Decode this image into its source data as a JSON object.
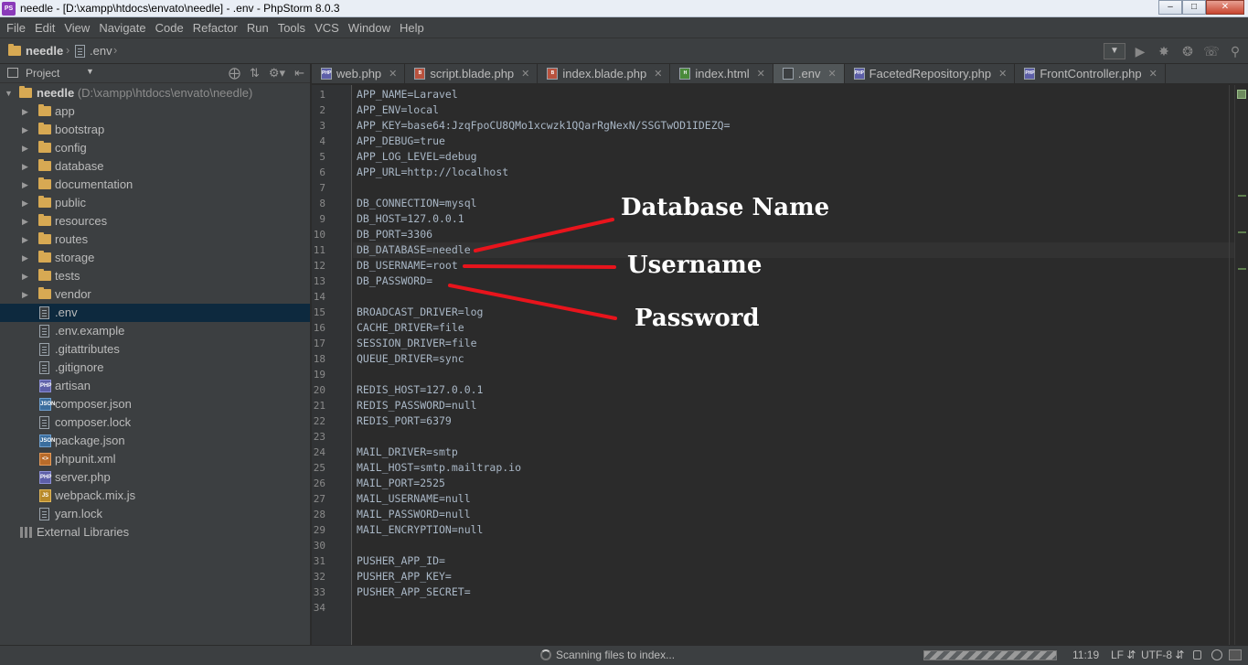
{
  "window": {
    "title": "needle - [D:\\xampp\\htdocs\\envato\\needle] - .env - PhpStorm 8.0.3",
    "controls": [
      "–",
      "□",
      "✕"
    ]
  },
  "menu": [
    "File",
    "Edit",
    "View",
    "Navigate",
    "Code",
    "Refactor",
    "Run",
    "Tools",
    "VCS",
    "Window",
    "Help"
  ],
  "breadcrumb": {
    "project": "needle",
    "file": ".env"
  },
  "project_panel": {
    "label": "Project",
    "root_name": "needle",
    "root_path": "(D:\\xampp\\htdocs\\envato\\needle)",
    "folders": [
      "app",
      "bootstrap",
      "config",
      "database",
      "documentation",
      "public",
      "resources",
      "routes",
      "storage",
      "tests",
      "vendor"
    ],
    "files": [
      {
        "name": ".env",
        "icon": "text"
      },
      {
        "name": ".env.example",
        "icon": "text"
      },
      {
        "name": ".gitattributes",
        "icon": "text"
      },
      {
        "name": ".gitignore",
        "icon": "text"
      },
      {
        "name": "artisan",
        "icon": "php"
      },
      {
        "name": "composer.json",
        "icon": "json"
      },
      {
        "name": "composer.lock",
        "icon": "text"
      },
      {
        "name": "package.json",
        "icon": "json"
      },
      {
        "name": "phpunit.xml",
        "icon": "xml"
      },
      {
        "name": "server.php",
        "icon": "php"
      },
      {
        "name": "webpack.mix.js",
        "icon": "js"
      },
      {
        "name": "yarn.lock",
        "icon": "text"
      }
    ],
    "external_libraries": "External Libraries",
    "selected": ".env"
  },
  "tabs": [
    {
      "label": "web.php",
      "icon": "php"
    },
    {
      "label": "script.blade.php",
      "icon": "blade"
    },
    {
      "label": "index.blade.php",
      "icon": "blade"
    },
    {
      "label": "index.html",
      "icon": "html"
    },
    {
      "label": ".env",
      "icon": "env",
      "active": true
    },
    {
      "label": "FacetedRepository.php",
      "icon": "php"
    },
    {
      "label": "FrontController.php",
      "icon": "php"
    }
  ],
  "editor": {
    "current_line": 11,
    "lines": [
      "APP_NAME=Laravel",
      "APP_ENV=local",
      "APP_KEY=base64:JzqFpoCU8QMo1xcwzk1QQarRgNexN/SSGTwOD1IDEZQ=",
      "APP_DEBUG=true",
      "APP_LOG_LEVEL=debug",
      "APP_URL=http://localhost",
      "",
      "DB_CONNECTION=mysql",
      "DB_HOST=127.0.0.1",
      "DB_PORT=3306",
      "DB_DATABASE=needle",
      "DB_USERNAME=root",
      "DB_PASSWORD=",
      "",
      "BROADCAST_DRIVER=log",
      "CACHE_DRIVER=file",
      "SESSION_DRIVER=file",
      "QUEUE_DRIVER=sync",
      "",
      "REDIS_HOST=127.0.0.1",
      "REDIS_PASSWORD=null",
      "REDIS_PORT=6379",
      "",
      "MAIL_DRIVER=smtp",
      "MAIL_HOST=smtp.mailtrap.io",
      "MAIL_PORT=2525",
      "MAIL_USERNAME=null",
      "MAIL_PASSWORD=null",
      "MAIL_ENCRYPTION=null",
      "",
      "PUSHER_APP_ID=",
      "PUSHER_APP_KEY=",
      "PUSHER_APP_SECRET=",
      ""
    ]
  },
  "annotations": [
    {
      "label": "Database Name",
      "line": 11
    },
    {
      "label": "Username",
      "line": 12
    },
    {
      "label": "Password",
      "line": 13
    }
  ],
  "annotation_color": "#e8141c",
  "statusbar": {
    "status": "Scanning files to index...",
    "position": "11:19",
    "line_separator": "LF",
    "encoding": "UTF-8"
  }
}
